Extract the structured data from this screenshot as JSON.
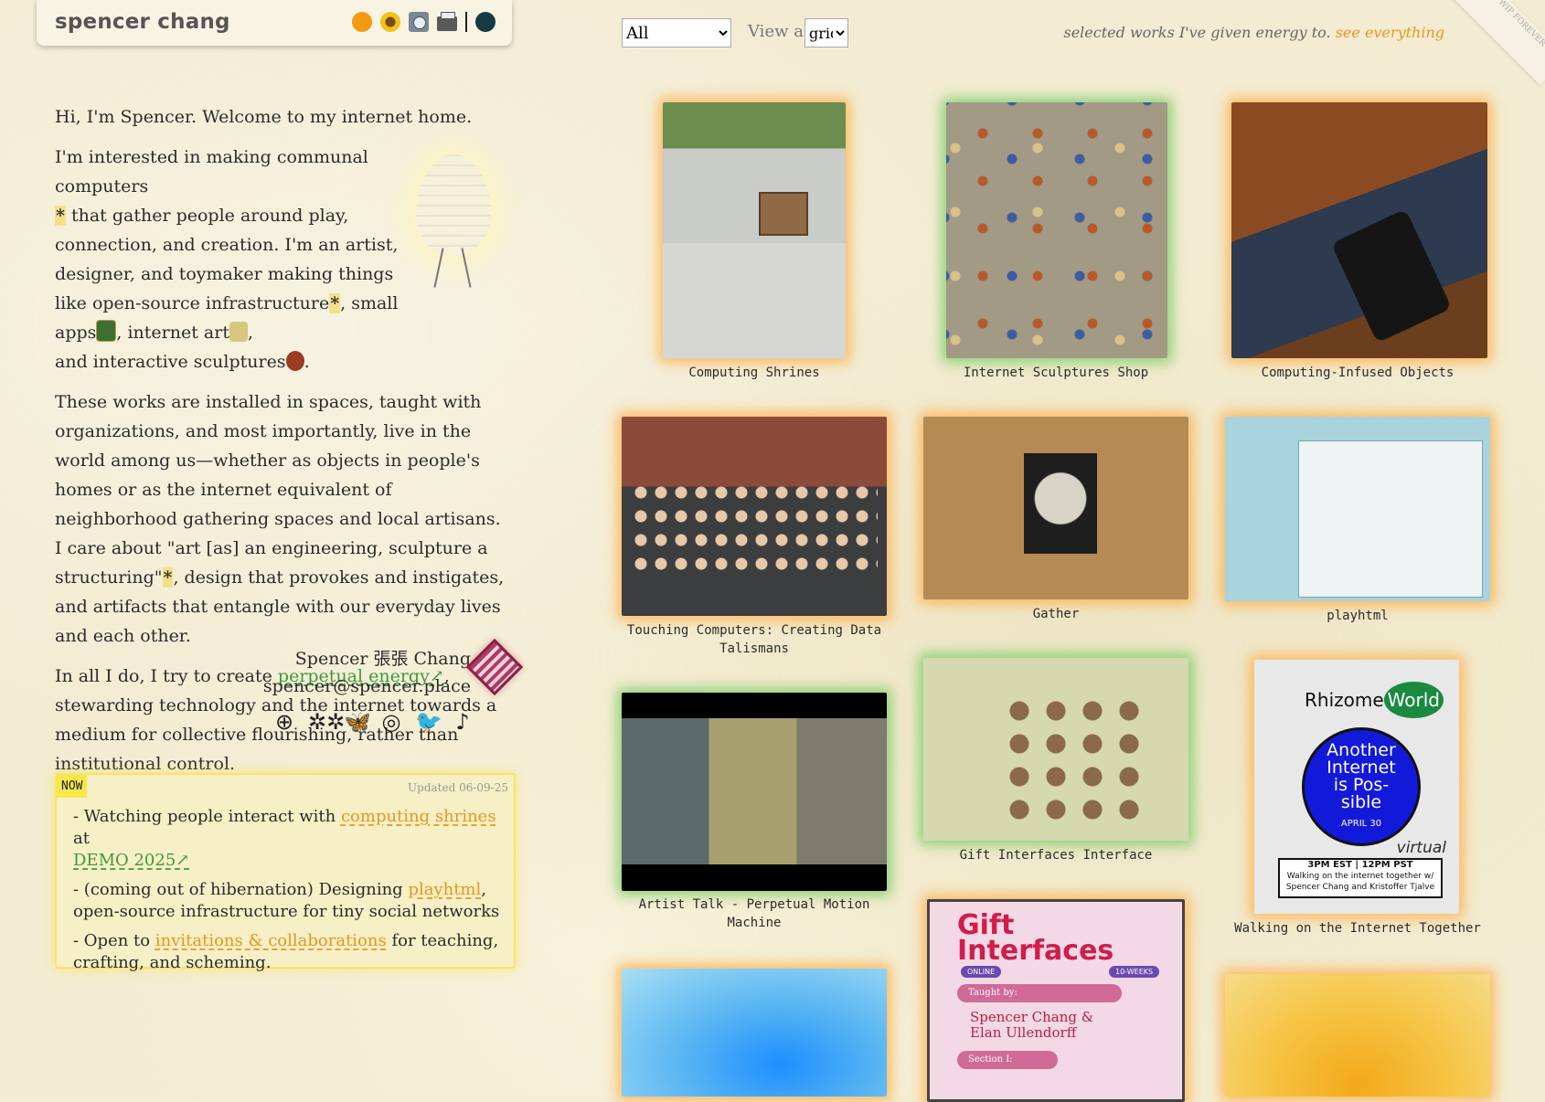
{
  "header": {
    "title": "spencer chang",
    "theme_icons": [
      "sun-icon",
      "sunflower-icon",
      "cd-icon",
      "printer-icon",
      "dark-mode-icon"
    ]
  },
  "intro": {
    "greeting": "Hi, I'm Spencer. Welcome to my internet home.",
    "p2_a": "I'm interested in making communal computers ",
    "star": "*",
    "p2_b": " that gather people around play, connection, and creation. I'm an artist, designer, and toymaker making things like open-source infrastructure",
    "p2_c": ", small apps",
    "p2_d": ", internet art",
    "p2_e": ",",
    "p2_f": "and interactive sculptures",
    "p2_g": ".",
    "p3_a": "These works are installed in spaces, taught with organizations, and most importantly, live in the world among us—whether as objects in people's homes or as the internet equivalent of neighborhood gathering spaces and local artisans. I care about \"art [as] an engineering, sculpture a structuring\"",
    "p3_b": ", design that provokes and instigates, and artifacts that entangle with our everyday lives and each other.",
    "p4_a": "In all I do, I try to create ",
    "p4_link": "perpetual energy↗",
    "p4_b": ", stewarding technology and the internet towards a medium for collective flourishing, rather than institutional control."
  },
  "signature": {
    "name": "Spencer 張張 Chang",
    "email": "spencer@spencer.place"
  },
  "socials": [
    {
      "name": "mailbox-icon",
      "glyph": "⊕"
    },
    {
      "name": "are-na-icon",
      "glyph": "✲✲"
    },
    {
      "name": "bluesky-icon",
      "glyph": "🦋"
    },
    {
      "name": "instagram-icon",
      "glyph": "◎"
    },
    {
      "name": "twitter-icon",
      "glyph": "🐦"
    },
    {
      "name": "tiktok-icon",
      "glyph": "♪"
    }
  ],
  "now": {
    "tag": "NOW",
    "updated": "Updated 06-09-25",
    "item1_a": "- Watching people interact with ",
    "item1_link": "computing shrines",
    "item1_b": " at",
    "item1_link2": "DEMO 2025↗",
    "item2_a": "- (coming out of hibernation) Designing ",
    "item2_link": "playhtml",
    "item2_b": ", open-source infrastructure for tiny social networks",
    "item3_a": "- Open to ",
    "item3_link": "invitations & collaborations",
    "item3_b": " for teaching, crafting, and scheming."
  },
  "controls": {
    "filter_value": "All",
    "view_label": "View as",
    "view_value": "grid",
    "tagline": "selected works I've given energy to.",
    "tagline_link": "see everything",
    "ribbon": "AS WIP FOREVER"
  },
  "works": [
    {
      "title": "Computing Shrines"
    },
    {
      "title": "Internet Sculptures Shop"
    },
    {
      "title": "Computing-Infused Objects"
    },
    {
      "title": "Touching Computers: Creating Data Talismans"
    },
    {
      "title": "Gather"
    },
    {
      "title": "playhtml"
    },
    {
      "title": "Artist Talk - Perpetual Motion Machine"
    },
    {
      "title": "Gift Interfaces Interface"
    },
    {
      "title": "Walking on the Internet Together"
    }
  ],
  "rhizome_poster": {
    "brand": "Rhizome",
    "world": "World",
    "line1": "Another",
    "line2": "Internet",
    "line3": "is Pos-",
    "line4": "sible",
    "date": "APRIL 30",
    "virtual": "virtual",
    "time": "3PM EST | 12PM PST",
    "sub1": "Walking on the internet together w/",
    "sub2": "Spencer Chang and Kristoffer Tjalve"
  },
  "gift_poster": {
    "title1": "Gift",
    "title2": "Interfaces",
    "tag_online": "ONLINE",
    "tag_weeks": "10-WEEKS",
    "taught_by": "Taught by:",
    "names1": "Spencer Chang &",
    "names2": "Elan Ullendorff",
    "section": "Section I:"
  },
  "colors": {
    "accent_green": "#3b9a3b",
    "accent_orange": "#e8961c",
    "now_yellow": "#f6e84b"
  }
}
